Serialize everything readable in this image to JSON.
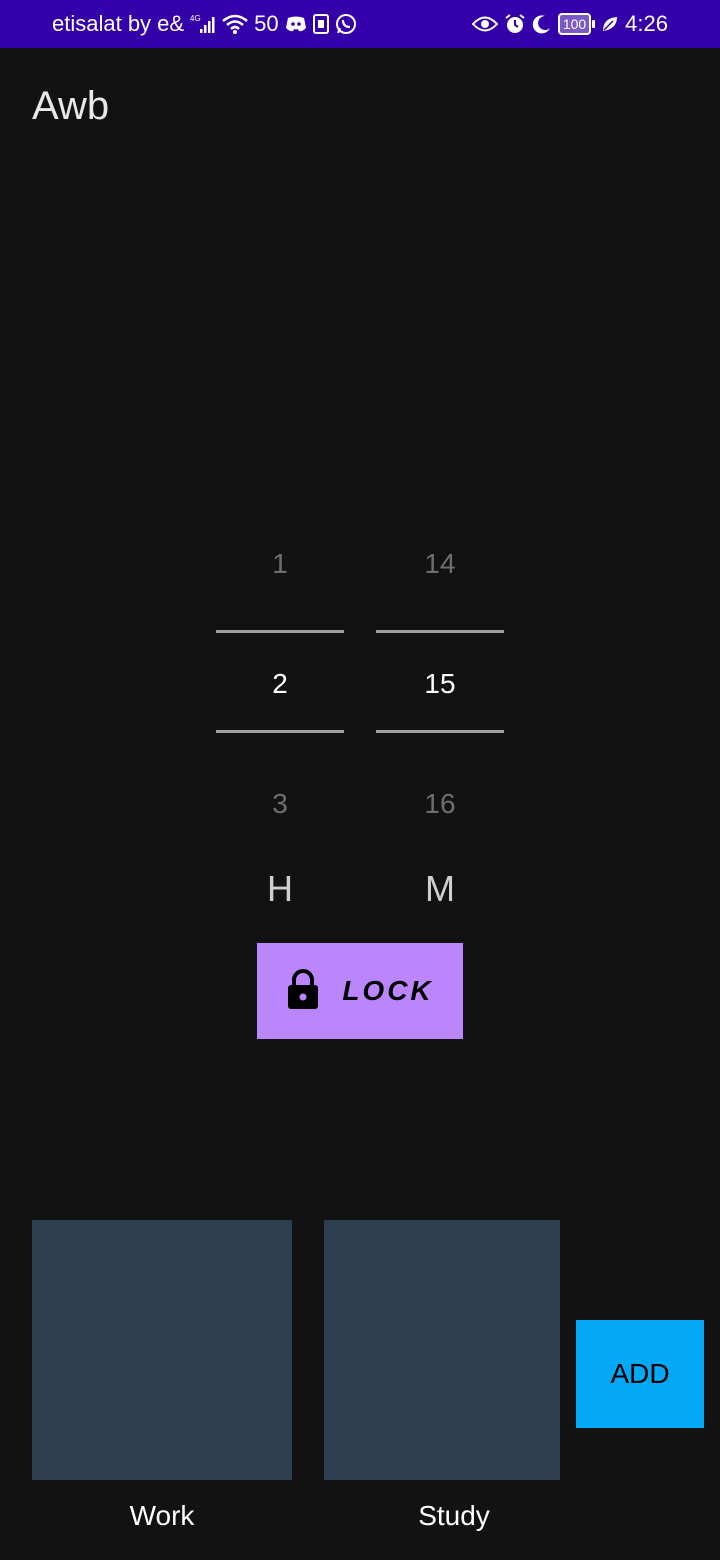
{
  "status_bar": {
    "carrier": "etisalat by e&",
    "network": "4G",
    "speed": "50",
    "battery": "100",
    "time": "4:26"
  },
  "app": {
    "title": "Awb"
  },
  "time_picker": {
    "hours": {
      "prev": "1",
      "selected": "2",
      "next": "3",
      "unit_label": "H"
    },
    "minutes": {
      "prev": "14",
      "selected": "15",
      "next": "16",
      "unit_label": "M"
    }
  },
  "lock_button": {
    "label": "LOCK",
    "icon": "lock-icon",
    "color": "#bb86fc"
  },
  "categories": [
    {
      "label": "Work"
    },
    {
      "label": "Study"
    }
  ],
  "add_button": {
    "label": "ADD",
    "color": "#03a9f4"
  },
  "colors": {
    "status_bar": "#3300aa",
    "background": "#121212",
    "tile": "#2c3e50"
  }
}
